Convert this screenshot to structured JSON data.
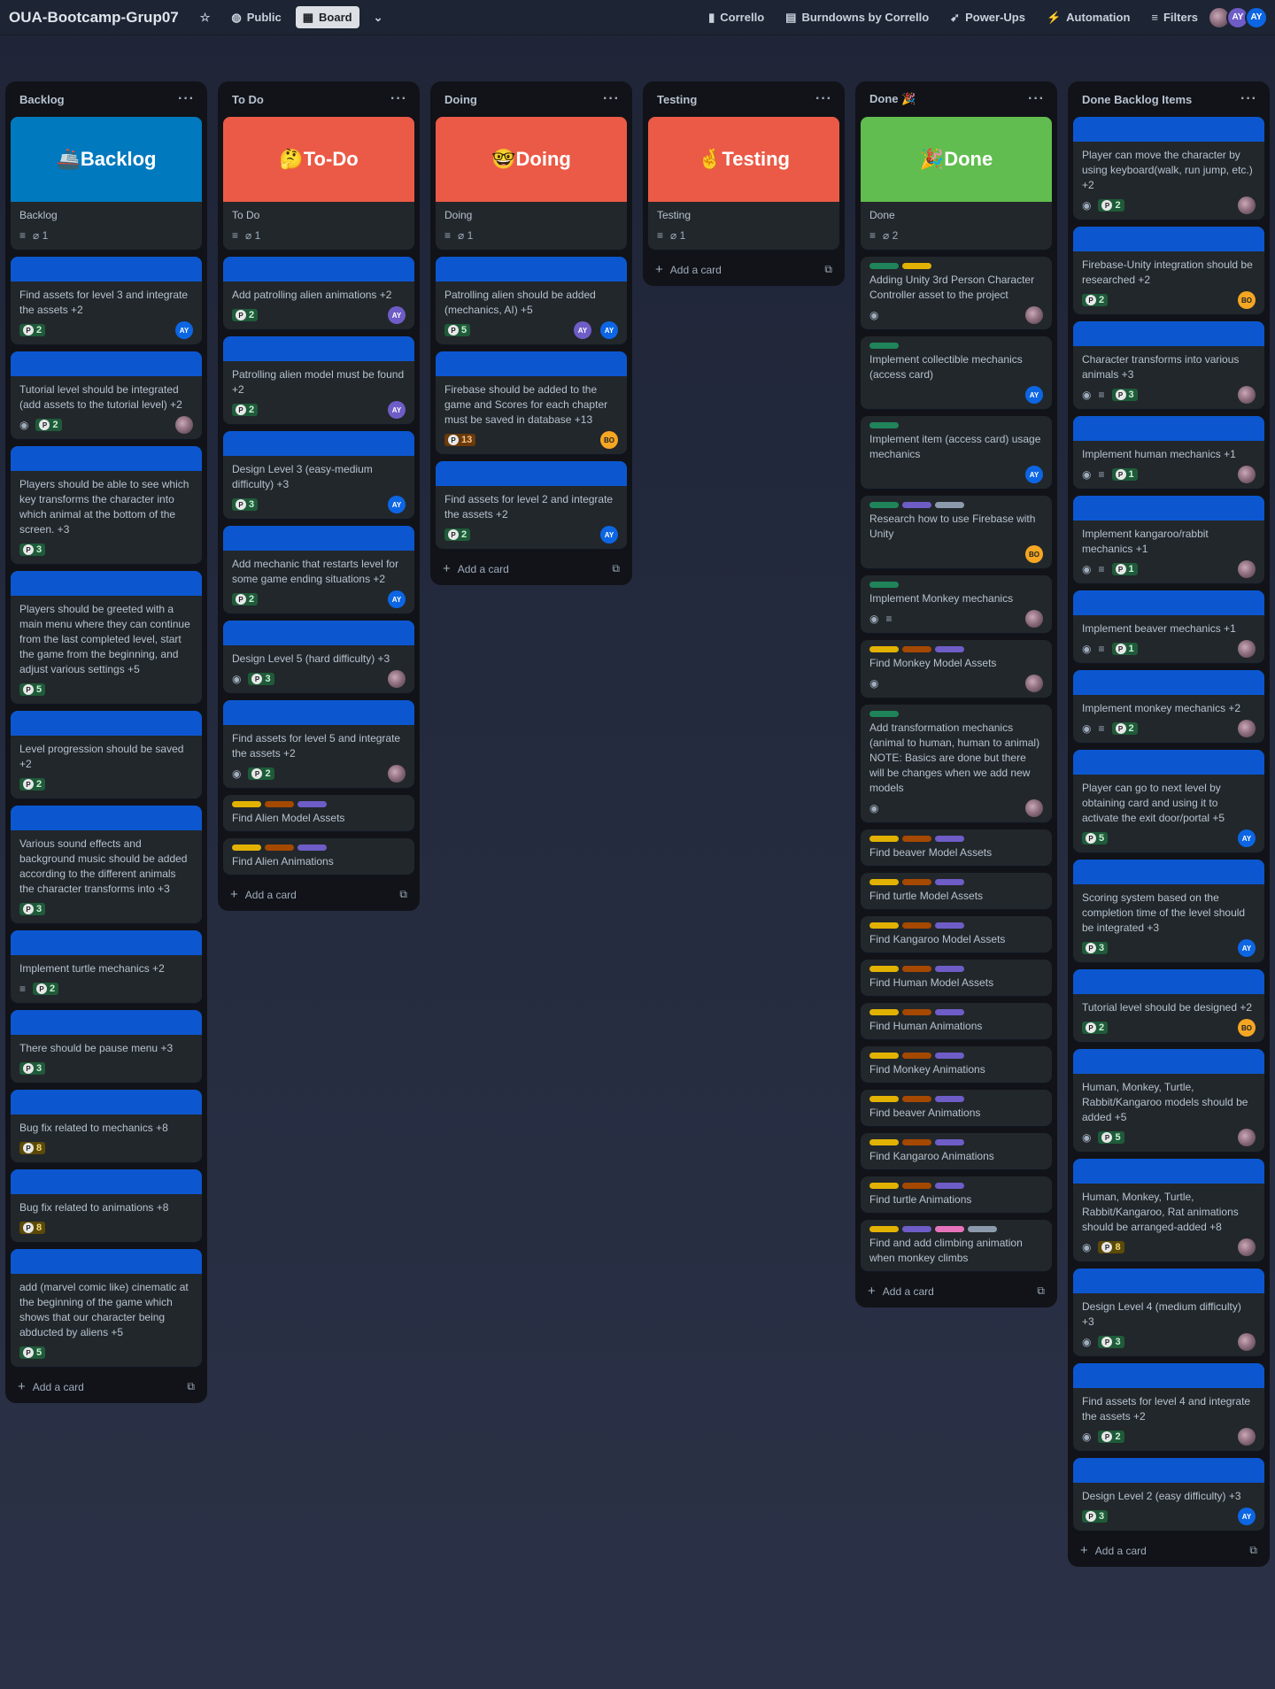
{
  "topbar": {
    "board_title": "OUA-Bootcamp-Grup07",
    "visibility": "Public",
    "view": "Board",
    "buttons": [
      "Corrello",
      "Burndowns by Corrello",
      "Power-Ups",
      "Automation",
      "Filters"
    ],
    "members": [
      "AY",
      "AY"
    ]
  },
  "lists": [
    {
      "title": "Backlog",
      "add": "Add a card",
      "cover": {
        "text": "Backlog",
        "emoji": "🚢",
        "color": "#0079bf"
      },
      "cards": [
        {
          "title": "Backlog",
          "badges": {
            "desc": true,
            "attach": "1"
          }
        },
        {
          "title": "Find assets for level 3 and integrate the assets +2",
          "stripe": true,
          "points": "2",
          "pc": "g",
          "member": "AY"
        },
        {
          "title": "Tutorial level should be integrated (add assets to the tutorial level) +2",
          "stripe": true,
          "eye": true,
          "points": "2",
          "pc": "g",
          "member": "photo"
        },
        {
          "title": "Players should be able to see which key transforms the character into which animal at the bottom of the screen. +3",
          "stripe": true,
          "points": "3",
          "pc": "g"
        },
        {
          "title": "Players should be greeted with a main menu where they can continue from the last completed level, start the game from the beginning, and adjust various settings +5",
          "stripe": true,
          "points": "5",
          "pc": "g"
        },
        {
          "title": "Level progression should be saved +2",
          "stripe": true,
          "points": "2",
          "pc": "g"
        },
        {
          "title": "Various sound effects and background music should be added according to the different animals the character transforms into +3",
          "stripe": true,
          "points": "3",
          "pc": "g"
        },
        {
          "title": "Implement turtle mechanics +2",
          "stripe": true,
          "desc": true,
          "points": "2",
          "pc": "g"
        },
        {
          "title": "There should be pause menu +3",
          "stripe": true,
          "points": "3",
          "pc": "g"
        },
        {
          "title": "Bug fix related to mechanics +8",
          "stripe": true,
          "points": "8",
          "pc": "y"
        },
        {
          "title": "Bug fix related to animations +8",
          "stripe": true,
          "points": "8",
          "pc": "y"
        },
        {
          "title": "add (marvel comic like) cinematic at the beginning of the game which shows that our character being abducted by aliens +5",
          "stripe": true,
          "points": "5",
          "pc": "g"
        }
      ]
    },
    {
      "title": "To Do",
      "add": "Add a card",
      "cover": {
        "text": "To-Do",
        "emoji": "🤔",
        "color": "#eb5a46"
      },
      "cards": [
        {
          "title": "To Do",
          "badges": {
            "desc": true,
            "attach": "1"
          }
        },
        {
          "title": "Add patrolling alien animations +2",
          "stripe": true,
          "points": "2",
          "pc": "g",
          "member": "AY2"
        },
        {
          "title": "Patrolling alien model must be found +2",
          "stripe": true,
          "points": "2",
          "pc": "g",
          "member": "AY2"
        },
        {
          "title": "Design Level 3 (easy-medium difficulty) +3",
          "stripe": true,
          "points": "3",
          "pc": "g",
          "member": "AY"
        },
        {
          "title": "Add mechanic that restarts level for some game ending situations +2",
          "stripe": true,
          "points": "2",
          "pc": "g",
          "member": "AY"
        },
        {
          "title": "Design Level 5 (hard difficulty) +3",
          "stripe": true,
          "eye": true,
          "points": "3",
          "pc": "g",
          "member": "photo"
        },
        {
          "title": "Find assets for level 5 and integrate the assets +2",
          "stripe": true,
          "eye": true,
          "points": "2",
          "pc": "g",
          "member": "photo"
        },
        {
          "title": "Find Alien Model Assets",
          "labels": [
            "#e2b203",
            "#a54800",
            "#6e5dc6"
          ]
        },
        {
          "title": "Find Alien Animations",
          "labels": [
            "#e2b203",
            "#a54800",
            "#6e5dc6"
          ]
        }
      ]
    },
    {
      "title": "Doing",
      "add": "Add a card",
      "cover": {
        "text": "Doing",
        "emoji": "🤓",
        "color": "#eb5a46"
      },
      "cards": [
        {
          "title": "Doing",
          "badges": {
            "desc": true,
            "attach": "1"
          }
        },
        {
          "title": "Patrolling alien should be added (mechanics, AI) +5",
          "stripe": true,
          "points": "5",
          "pc": "g",
          "member": "AY2",
          "member2": "AY"
        },
        {
          "title": "Firebase should be added to the game and Scores for each chapter must be saved in database +13",
          "stripe": true,
          "points": "13",
          "pc": "o",
          "member": "BO"
        },
        {
          "title": "Find assets for level 2 and integrate the assets +2",
          "stripe": true,
          "points": "2",
          "pc": "g",
          "member": "AY"
        }
      ]
    },
    {
      "title": "Testing",
      "add": "Add a card",
      "cover": {
        "text": "Testing",
        "emoji": "🤞",
        "color": "#eb5a46"
      },
      "cards": [
        {
          "title": "Testing",
          "badges": {
            "desc": true,
            "attach": "1"
          }
        }
      ]
    },
    {
      "title": "Done 🎉",
      "add": "Add a card",
      "cover": {
        "text": "Done",
        "emoji": "🎉",
        "color": "#61bd4f"
      },
      "cards": [
        {
          "title": "Done",
          "badges": {
            "desc": true,
            "attach": "2"
          }
        },
        {
          "title": "Adding Unity 3rd Person Character Controller asset to the project",
          "labels": [
            "#1f845a",
            "#e2b203"
          ],
          "eye": true,
          "member": "photo"
        },
        {
          "title": "Implement collectible mechanics (access card)",
          "labels": [
            "#1f845a"
          ],
          "member": "AY"
        },
        {
          "title": "Implement item (access card) usage mechanics",
          "labels": [
            "#1f845a"
          ],
          "member": "AY"
        },
        {
          "title": "Research how to use Firebase with Unity",
          "labels": [
            "#1f845a",
            "#6e5dc6",
            "#8c9bab"
          ],
          "member": "BO"
        },
        {
          "title": "Implement Monkey mechanics",
          "labels": [
            "#1f845a"
          ],
          "eye": true,
          "desc": true,
          "member": "photo"
        },
        {
          "title": "Find Monkey Model Assets",
          "labels": [
            "#e2b203",
            "#a54800",
            "#6e5dc6"
          ],
          "eye": true,
          "member": "photo"
        },
        {
          "title": "Add transformation mechanics (animal to human, human to animal) NOTE: Basics are done but there will be changes when we add new models",
          "labels": [
            "#1f845a"
          ],
          "eye": true,
          "member": "photo"
        },
        {
          "title": "Find beaver Model Assets",
          "labels": [
            "#e2b203",
            "#a54800",
            "#6e5dc6"
          ]
        },
        {
          "title": "Find turtle Model Assets",
          "labels": [
            "#e2b203",
            "#a54800",
            "#6e5dc6"
          ]
        },
        {
          "title": "Find Kangaroo Model Assets",
          "labels": [
            "#e2b203",
            "#a54800",
            "#6e5dc6"
          ]
        },
        {
          "title": "Find Human Model Assets",
          "labels": [
            "#e2b203",
            "#a54800",
            "#6e5dc6"
          ]
        },
        {
          "title": "Find Human Animations",
          "labels": [
            "#e2b203",
            "#a54800",
            "#6e5dc6"
          ]
        },
        {
          "title": "Find Monkey Animations",
          "labels": [
            "#e2b203",
            "#a54800",
            "#6e5dc6"
          ]
        },
        {
          "title": "Find beaver Animations",
          "labels": [
            "#e2b203",
            "#a54800",
            "#6e5dc6"
          ]
        },
        {
          "title": "Find Kangaroo Animations",
          "labels": [
            "#e2b203",
            "#a54800",
            "#6e5dc6"
          ]
        },
        {
          "title": "Find turtle Animations",
          "labels": [
            "#e2b203",
            "#a54800",
            "#6e5dc6"
          ]
        },
        {
          "title": "Find and add climbing animation when monkey climbs",
          "labels": [
            "#e2b203",
            "#6e5dc6",
            "#e774bb",
            "#8c9bab"
          ]
        }
      ]
    },
    {
      "title": "Done Backlog Items",
      "add": "Add a card",
      "cards": [
        {
          "title": "Player can move the character by using keyboard(walk, run jump, etc.) +2",
          "stripe": true,
          "eye": true,
          "points": "2",
          "pc": "g",
          "member": "photo"
        },
        {
          "title": "Firebase-Unity integration should be researched +2",
          "stripe": true,
          "points": "2",
          "pc": "g",
          "member": "BO"
        },
        {
          "title": "Character transforms into various animals +3",
          "stripe": true,
          "eye": true,
          "desc": true,
          "points": "3",
          "pc": "g",
          "member": "photo"
        },
        {
          "title": "Implement human mechanics +1",
          "stripe": true,
          "eye": true,
          "desc": true,
          "points": "1",
          "pc": "g",
          "member": "photo"
        },
        {
          "title": "Implement kangaroo/rabbit mechanics +1",
          "stripe": true,
          "eye": true,
          "desc": true,
          "points": "1",
          "pc": "g",
          "member": "photo"
        },
        {
          "title": "Implement beaver mechanics +1",
          "stripe": true,
          "eye": true,
          "desc": true,
          "points": "1",
          "pc": "g",
          "member": "photo"
        },
        {
          "title": "Implement monkey mechanics +2",
          "stripe": true,
          "eye": true,
          "desc": true,
          "points": "2",
          "pc": "g",
          "member": "photo"
        },
        {
          "title": "Player can go to next level by obtaining card and using it to activate the exit door/portal +5",
          "stripe": true,
          "points": "5",
          "pc": "g",
          "member": "AY"
        },
        {
          "title": "Scoring system based on the completion time of the level should be integrated +3",
          "stripe": true,
          "points": "3",
          "pc": "g",
          "member": "AY"
        },
        {
          "title": "Tutorial level should be designed +2",
          "stripe": true,
          "points": "2",
          "pc": "g",
          "member": "BO"
        },
        {
          "title": "Human, Monkey, Turtle, Rabbit/Kangaroo models should be added +5",
          "stripe": true,
          "eye": true,
          "points": "5",
          "pc": "g",
          "member": "photo"
        },
        {
          "title": "Human, Monkey, Turtle, Rabbit/Kangaroo, Rat animations should be arranged-added +8",
          "stripe": true,
          "eye": true,
          "points": "8",
          "pc": "y",
          "member": "photo"
        },
        {
          "title": "Design Level 4 (medium difficulty) +3",
          "stripe": true,
          "eye": true,
          "points": "3",
          "pc": "g",
          "member": "photo"
        },
        {
          "title": "Find assets for level 4 and integrate the assets +2",
          "stripe": true,
          "eye": true,
          "points": "2",
          "pc": "g",
          "member": "photo"
        },
        {
          "title": "Design Level 2 (easy difficulty) +3",
          "stripe": true,
          "points": "3",
          "pc": "g",
          "member": "AY"
        }
      ]
    }
  ]
}
